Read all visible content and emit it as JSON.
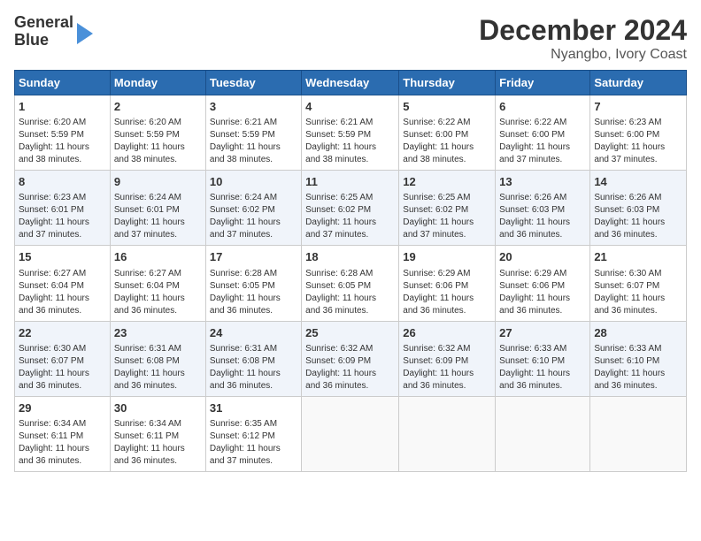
{
  "logo": {
    "line1": "General",
    "line2": "Blue"
  },
  "title": "December 2024",
  "subtitle": "Nyangbo, Ivory Coast",
  "days_header": [
    "Sunday",
    "Monday",
    "Tuesday",
    "Wednesday",
    "Thursday",
    "Friday",
    "Saturday"
  ],
  "weeks": [
    [
      {
        "day": "1",
        "info": "Sunrise: 6:20 AM\nSunset: 5:59 PM\nDaylight: 11 hours\nand 38 minutes."
      },
      {
        "day": "2",
        "info": "Sunrise: 6:20 AM\nSunset: 5:59 PM\nDaylight: 11 hours\nand 38 minutes."
      },
      {
        "day": "3",
        "info": "Sunrise: 6:21 AM\nSunset: 5:59 PM\nDaylight: 11 hours\nand 38 minutes."
      },
      {
        "day": "4",
        "info": "Sunrise: 6:21 AM\nSunset: 5:59 PM\nDaylight: 11 hours\nand 38 minutes."
      },
      {
        "day": "5",
        "info": "Sunrise: 6:22 AM\nSunset: 6:00 PM\nDaylight: 11 hours\nand 38 minutes."
      },
      {
        "day": "6",
        "info": "Sunrise: 6:22 AM\nSunset: 6:00 PM\nDaylight: 11 hours\nand 37 minutes."
      },
      {
        "day": "7",
        "info": "Sunrise: 6:23 AM\nSunset: 6:00 PM\nDaylight: 11 hours\nand 37 minutes."
      }
    ],
    [
      {
        "day": "8",
        "info": "Sunrise: 6:23 AM\nSunset: 6:01 PM\nDaylight: 11 hours\nand 37 minutes."
      },
      {
        "day": "9",
        "info": "Sunrise: 6:24 AM\nSunset: 6:01 PM\nDaylight: 11 hours\nand 37 minutes."
      },
      {
        "day": "10",
        "info": "Sunrise: 6:24 AM\nSunset: 6:02 PM\nDaylight: 11 hours\nand 37 minutes."
      },
      {
        "day": "11",
        "info": "Sunrise: 6:25 AM\nSunset: 6:02 PM\nDaylight: 11 hours\nand 37 minutes."
      },
      {
        "day": "12",
        "info": "Sunrise: 6:25 AM\nSunset: 6:02 PM\nDaylight: 11 hours\nand 37 minutes."
      },
      {
        "day": "13",
        "info": "Sunrise: 6:26 AM\nSunset: 6:03 PM\nDaylight: 11 hours\nand 36 minutes."
      },
      {
        "day": "14",
        "info": "Sunrise: 6:26 AM\nSunset: 6:03 PM\nDaylight: 11 hours\nand 36 minutes."
      }
    ],
    [
      {
        "day": "15",
        "info": "Sunrise: 6:27 AM\nSunset: 6:04 PM\nDaylight: 11 hours\nand 36 minutes."
      },
      {
        "day": "16",
        "info": "Sunrise: 6:27 AM\nSunset: 6:04 PM\nDaylight: 11 hours\nand 36 minutes."
      },
      {
        "day": "17",
        "info": "Sunrise: 6:28 AM\nSunset: 6:05 PM\nDaylight: 11 hours\nand 36 minutes."
      },
      {
        "day": "18",
        "info": "Sunrise: 6:28 AM\nSunset: 6:05 PM\nDaylight: 11 hours\nand 36 minutes."
      },
      {
        "day": "19",
        "info": "Sunrise: 6:29 AM\nSunset: 6:06 PM\nDaylight: 11 hours\nand 36 minutes."
      },
      {
        "day": "20",
        "info": "Sunrise: 6:29 AM\nSunset: 6:06 PM\nDaylight: 11 hours\nand 36 minutes."
      },
      {
        "day": "21",
        "info": "Sunrise: 6:30 AM\nSunset: 6:07 PM\nDaylight: 11 hours\nand 36 minutes."
      }
    ],
    [
      {
        "day": "22",
        "info": "Sunrise: 6:30 AM\nSunset: 6:07 PM\nDaylight: 11 hours\nand 36 minutes."
      },
      {
        "day": "23",
        "info": "Sunrise: 6:31 AM\nSunset: 6:08 PM\nDaylight: 11 hours\nand 36 minutes."
      },
      {
        "day": "24",
        "info": "Sunrise: 6:31 AM\nSunset: 6:08 PM\nDaylight: 11 hours\nand 36 minutes."
      },
      {
        "day": "25",
        "info": "Sunrise: 6:32 AM\nSunset: 6:09 PM\nDaylight: 11 hours\nand 36 minutes."
      },
      {
        "day": "26",
        "info": "Sunrise: 6:32 AM\nSunset: 6:09 PM\nDaylight: 11 hours\nand 36 minutes."
      },
      {
        "day": "27",
        "info": "Sunrise: 6:33 AM\nSunset: 6:10 PM\nDaylight: 11 hours\nand 36 minutes."
      },
      {
        "day": "28",
        "info": "Sunrise: 6:33 AM\nSunset: 6:10 PM\nDaylight: 11 hours\nand 36 minutes."
      }
    ],
    [
      {
        "day": "29",
        "info": "Sunrise: 6:34 AM\nSunset: 6:11 PM\nDaylight: 11 hours\nand 36 minutes."
      },
      {
        "day": "30",
        "info": "Sunrise: 6:34 AM\nSunset: 6:11 PM\nDaylight: 11 hours\nand 36 minutes."
      },
      {
        "day": "31",
        "info": "Sunrise: 6:35 AM\nSunset: 6:12 PM\nDaylight: 11 hours\nand 37 minutes."
      },
      {
        "day": "",
        "info": ""
      },
      {
        "day": "",
        "info": ""
      },
      {
        "day": "",
        "info": ""
      },
      {
        "day": "",
        "info": ""
      }
    ]
  ]
}
